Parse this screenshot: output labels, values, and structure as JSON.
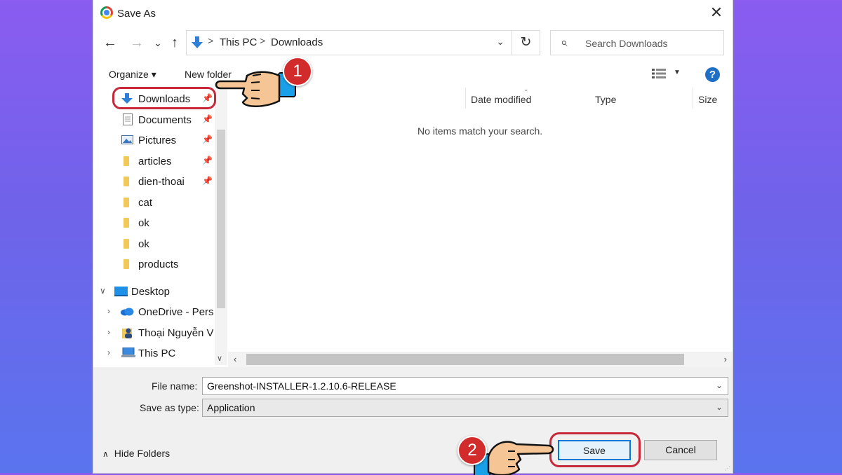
{
  "window": {
    "title": "Save As",
    "close_label": "✕"
  },
  "nav": {
    "back": "←",
    "forward": "→",
    "recent": "⌄",
    "up": "↑",
    "refresh": "↻"
  },
  "address": {
    "segments": [
      "This PC",
      "Downloads"
    ],
    "separator": ">"
  },
  "search": {
    "placeholder": "Search Downloads"
  },
  "toolbar": {
    "organize": "Organize ▾",
    "new_folder": "New folder",
    "help": "?"
  },
  "sidebar": {
    "quick_access": [
      {
        "label": "Downloads",
        "pinned": true
      },
      {
        "label": "Documents",
        "pinned": true
      },
      {
        "label": "Pictures",
        "pinned": true
      },
      {
        "label": "articles",
        "pinned": true
      },
      {
        "label": "dien-thoai",
        "pinned": true
      },
      {
        "label": "cat",
        "pinned": false
      },
      {
        "label": "ok",
        "pinned": false
      },
      {
        "label": "ok",
        "pinned": false
      },
      {
        "label": "products",
        "pinned": false
      }
    ],
    "tree": [
      {
        "label": "Desktop",
        "expanded": true
      },
      {
        "label": "OneDrive - Persc",
        "expanded": false
      },
      {
        "label": "Thoại Nguyễn Vă",
        "expanded": false
      },
      {
        "label": "This PC",
        "expanded": false
      }
    ]
  },
  "columns": [
    "Date modified",
    "Type",
    "Size"
  ],
  "empty_message": "No items match your search.",
  "form": {
    "file_name_label": "File name:",
    "file_name_value": "Greenshot-INSTALLER-1.2.10.6-RELEASE",
    "save_type_label": "Save as type:",
    "save_type_value": "Application"
  },
  "footer": {
    "hide_folders": "Hide Folders",
    "save": "Save",
    "cancel": "Cancel"
  },
  "annotations": {
    "step1": "1",
    "step2": "2"
  },
  "colors": {
    "accent": "#0078d7",
    "highlight": "#c7283a",
    "badge": "#d22b2b",
    "background_top": "#8a5cf0",
    "background_bottom": "#5a74ee"
  }
}
